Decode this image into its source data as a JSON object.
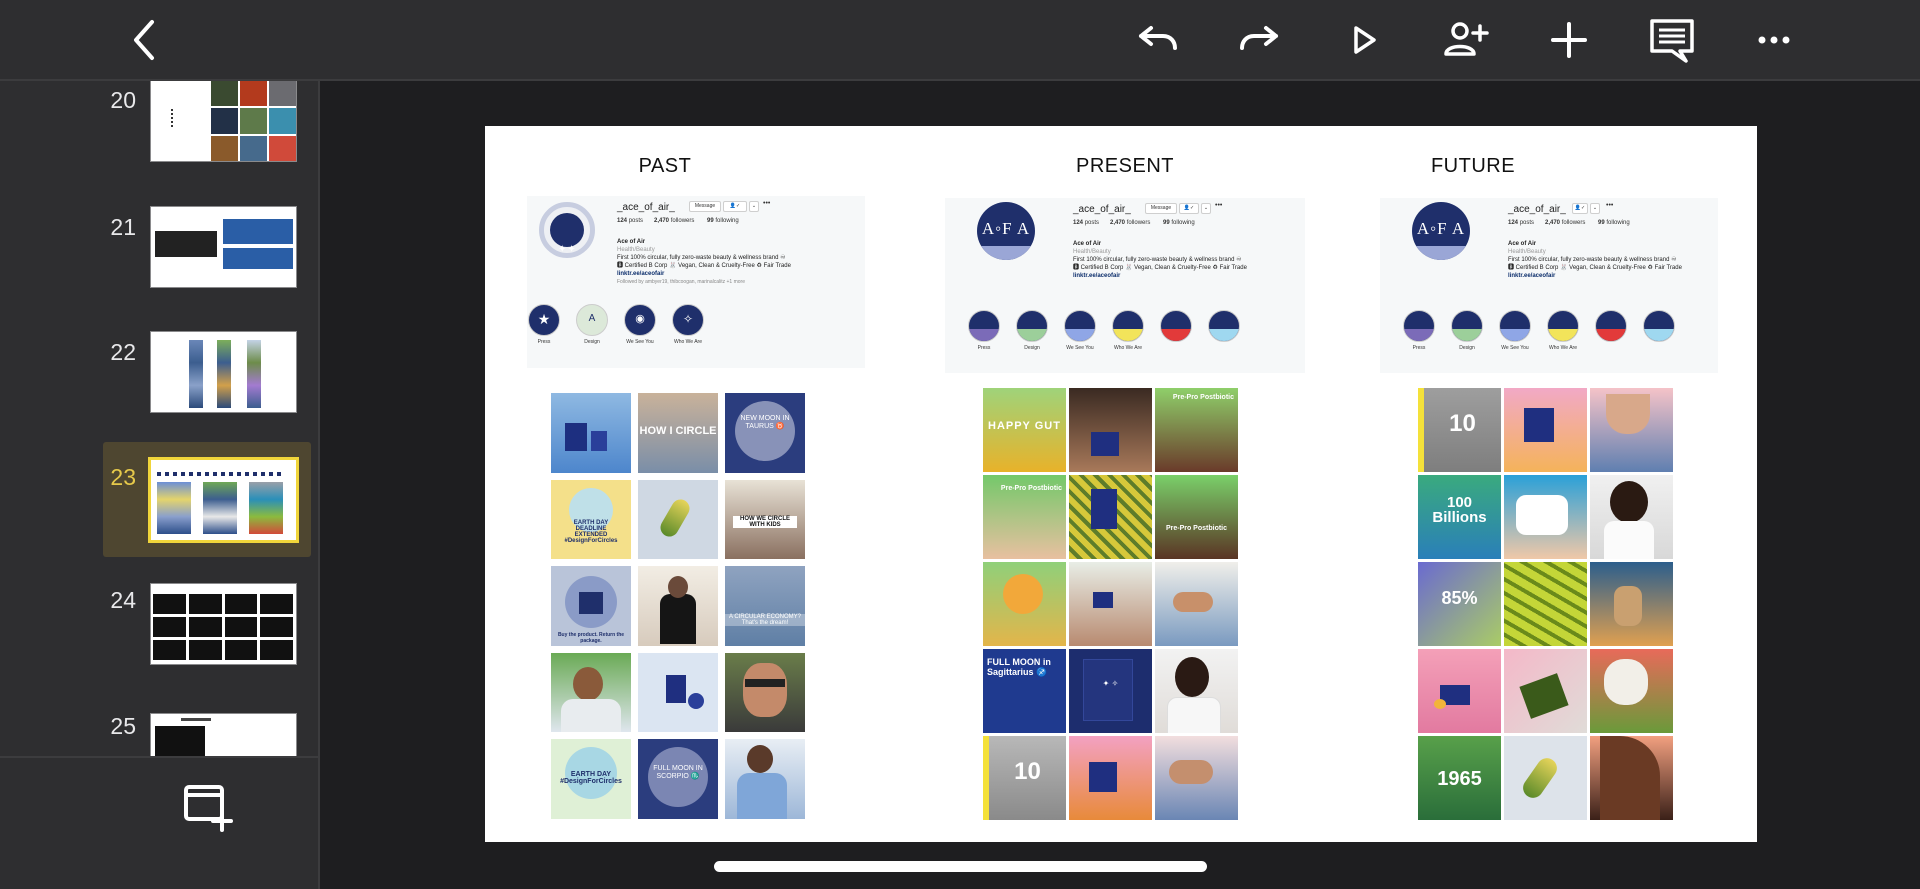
{
  "toolbar": {
    "back_icon": "chevron-left-icon",
    "undo_icon": "undo-icon",
    "redo_icon": "redo-icon",
    "play_icon": "play-icon",
    "collaborate_icon": "add-person-icon",
    "insert_icon": "plus-icon",
    "comment_icon": "comment-icon",
    "more_icon": "more-icon"
  },
  "sidebar": {
    "slides": [
      {
        "number": "20"
      },
      {
        "number": "21"
      },
      {
        "number": "22"
      },
      {
        "number": "23",
        "active": true
      },
      {
        "number": "24"
      },
      {
        "number": "25"
      }
    ],
    "add_slide_icon": "add-slide-icon"
  },
  "slide": {
    "columns": [
      {
        "title": "PAST",
        "profile": {
          "handle": "_ace_of_air_",
          "message_btn": "Message",
          "posts": "124",
          "posts_label": "posts",
          "followers": "2,470",
          "followers_label": "followers",
          "following": "99",
          "following_label": "following",
          "name": "Ace of Air",
          "category": "Health/Beauty",
          "bio1": "First 100% circular, fully zero-waste beauty & wellness brand ♾",
          "bio2": "🅱 Certified B Corp 🐰 Vegan, Clean & Cruelty-Free ♻ Fair Trade",
          "link": "linktr.ee/aceofair",
          "followed_by": "Followed by ambyer19, thibcoogan, marinalcalitz +1 more",
          "highlights": [
            "Press",
            "Design",
            "We See You",
            "Who We Are"
          ]
        },
        "tiles": [
          {
            "text": ""
          },
          {
            "text": "HOW I CIRCLE"
          },
          {
            "text": "NEW MOON IN TAURUS ♉"
          },
          {
            "text": "EARTH DAY DEADLINE EXTENDED #DesignForCircles"
          },
          {
            "text": ""
          },
          {
            "text": "HOW WE CIRCLE WITH KIDS"
          },
          {
            "text": "Buy the product. Return the package."
          },
          {
            "text": ""
          },
          {
            "text": "A CIRCULAR ECONOMY? That's the dream!"
          },
          {
            "text": ""
          },
          {
            "text": ""
          },
          {
            "text": ""
          },
          {
            "text": "EARTH DAY #DesignForCircles"
          },
          {
            "text": "FULL MOON IN SCORPIO ♏"
          },
          {
            "text": ""
          }
        ]
      },
      {
        "title": "PRESENT",
        "profile": {
          "handle": "_ace_of_air_",
          "message_btn": "Message",
          "posts": "124",
          "posts_label": "posts",
          "followers": "2,470",
          "followers_label": "followers",
          "following": "99",
          "following_label": "following",
          "name": "Ace of Air",
          "category": "Health/Beauty",
          "bio1": "First 100% circular, fully zero-waste beauty & wellness brand ♾",
          "bio2": "🅱 Certified B Corp 🐰 Vegan, Clean & Cruelty-Free ♻ Fair Trade",
          "link": "linktr.ee/aceofair",
          "highlights": [
            "Press",
            "Design",
            "We See You",
            "Who We Are"
          ]
        },
        "tiles": [
          {
            "text": "HAPPY GUT"
          },
          {
            "text": ""
          },
          {
            "text": "Pre-Pro Postbiotic"
          },
          {
            "text": "Pre-Pro Postbiotic"
          },
          {
            "text": ""
          },
          {
            "text": "Pre-Pro Postbiotic"
          },
          {
            "text": ""
          },
          {
            "text": ""
          },
          {
            "text": ""
          },
          {
            "text": "FULL MOON in Sagittarius ♐"
          },
          {
            "text": ""
          },
          {
            "text": ""
          },
          {
            "text": "10"
          },
          {
            "text": ""
          },
          {
            "text": ""
          }
        ]
      },
      {
        "title": "FUTURE",
        "profile": {
          "handle": "_ace_of_air_",
          "message_btn": "Message",
          "posts": "124",
          "posts_label": "posts",
          "followers": "2,470",
          "followers_label": "followers",
          "following": "99",
          "following_label": "following",
          "name": "Ace of Air",
          "category": "Health/Beauty",
          "bio1": "First 100% circular, fully zero-waste beauty & wellness brand ♾",
          "bio2": "🅱 Certified B Corp 🐰 Vegan, Clean & Cruelty-Free ♻ Fair Trade",
          "link": "linktr.ee/aceofair",
          "highlights": [
            "Press",
            "Design",
            "We See You",
            "Who We Are"
          ]
        },
        "tiles": [
          {
            "text": "10"
          },
          {
            "text": ""
          },
          {
            "text": ""
          },
          {
            "text": "100 Billions"
          },
          {
            "text": ""
          },
          {
            "text": ""
          },
          {
            "text": "85%"
          },
          {
            "text": ""
          },
          {
            "text": ""
          },
          {
            "text": ""
          },
          {
            "text": ""
          },
          {
            "text": ""
          },
          {
            "text": "1965"
          },
          {
            "text": ""
          },
          {
            "text": ""
          }
        ]
      }
    ]
  },
  "colors": {
    "toolbar_bg": "#2e2e30",
    "app_bg": "#1e1e20",
    "active_number": "#e6c94a",
    "active_border": "#f0d53a",
    "brand_navy": "#1f2f6b"
  }
}
